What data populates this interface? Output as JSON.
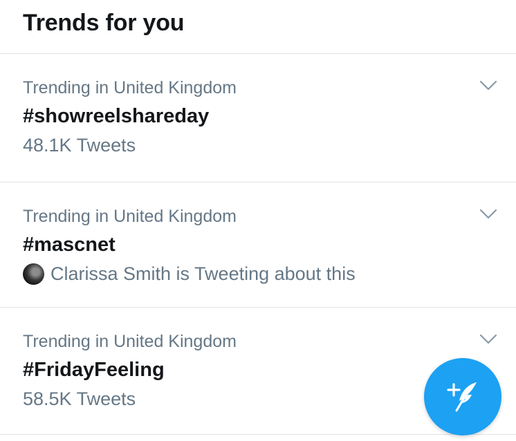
{
  "header": {
    "title": "Trends for you"
  },
  "trends": [
    {
      "context": "Trending in United Kingdom",
      "name": "#showreelshareday",
      "meta": "48.1K Tweets"
    },
    {
      "context": "Trending in United Kingdom",
      "name": "#mascnet",
      "meta": "Clarissa Smith is Tweeting about this"
    },
    {
      "context": "Trending in United Kingdom",
      "name": "#FridayFeeling",
      "meta": "58.5K Tweets"
    }
  ],
  "icons": {
    "chevron": "chevron-down-icon",
    "compose": "compose-tweet-icon"
  },
  "colors": {
    "accent": "#1da1f2",
    "secondary_text": "#657786",
    "primary_text": "#14171a",
    "divider": "#dfe3e7"
  }
}
